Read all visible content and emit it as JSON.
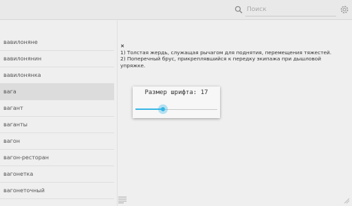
{
  "header": {
    "search_placeholder": "Поиск",
    "search_value": ""
  },
  "word_list": {
    "items": [
      "вавилоняне",
      "вавилонянин",
      "вавилонянка",
      "вага",
      "вагант",
      "ваганты",
      "вагон",
      "вагон-ресторан",
      "вагонетка",
      "вагонеточный"
    ],
    "selected_index": 3
  },
  "definition": {
    "headword": "×",
    "lines": [
      "1) Толстая жердь, служащая рычагом для поднятия, перемещения тяжестей.",
      "2) Поперечный брус, прикреплявшийся к передку экипажа при дышловой упряжке."
    ]
  },
  "font_dialog": {
    "label": "Размер шрифта: 17",
    "slider_fraction": 0.34
  },
  "colors": {
    "accent": "#33b5e5",
    "background": "#efefef",
    "selected_row": "#dcdcdc"
  },
  "icons": {
    "search": "search-icon",
    "settings": "gear-icon",
    "list": "list-icon",
    "resize": "resize-icon"
  }
}
